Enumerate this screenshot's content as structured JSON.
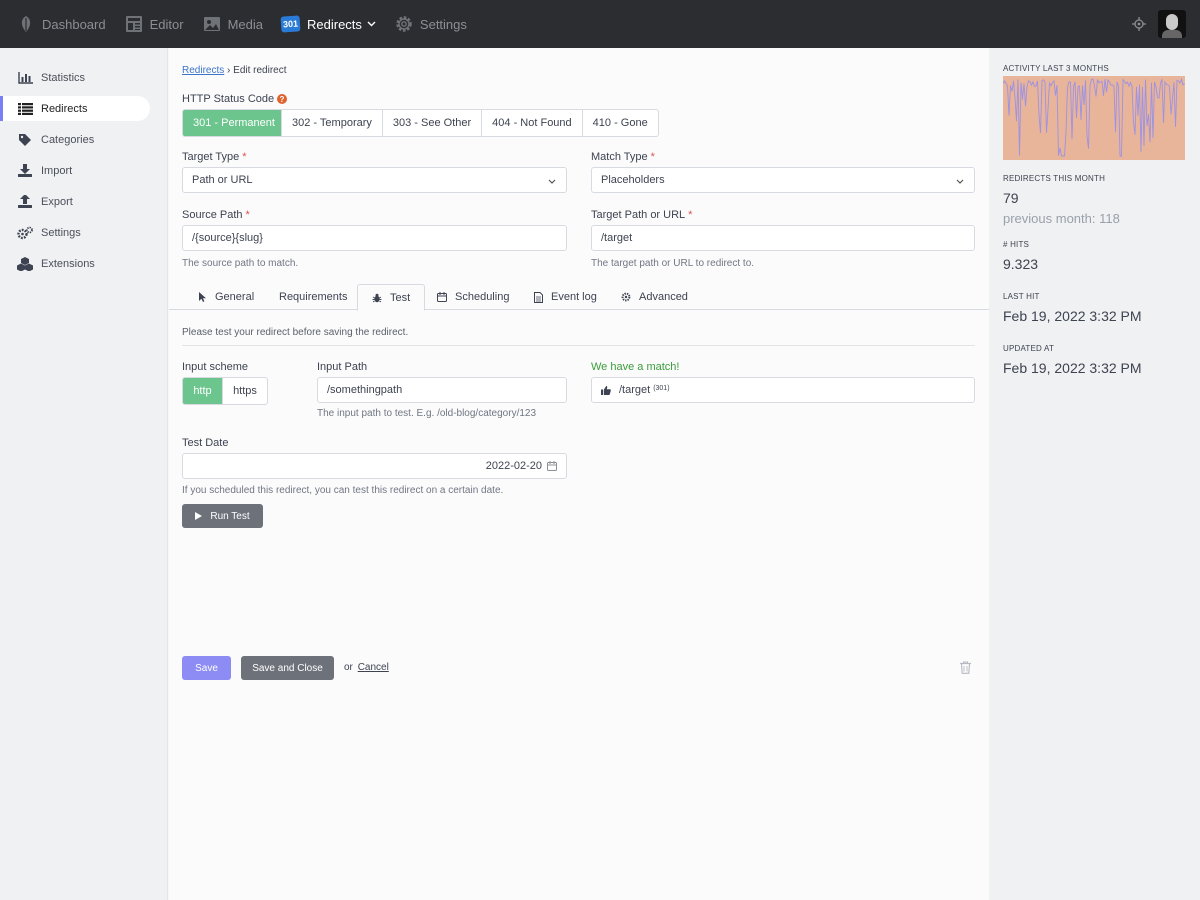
{
  "topnav": {
    "items": [
      {
        "label": "Dashboard",
        "icon": "dashboard-icon"
      },
      {
        "label": "Editor",
        "icon": "editor-icon"
      },
      {
        "label": "Media",
        "icon": "media-icon"
      },
      {
        "label": "Redirects",
        "icon": "redirects-301-icon",
        "badge": "301"
      },
      {
        "label": "Settings",
        "icon": "settings-gear-icon"
      }
    ],
    "active": "Redirects"
  },
  "sidebar": {
    "items": [
      {
        "label": "Statistics",
        "icon": "bar-chart-icon"
      },
      {
        "label": "Redirects",
        "icon": "list-icon"
      },
      {
        "label": "Categories",
        "icon": "tag-icon"
      },
      {
        "label": "Import",
        "icon": "download-icon"
      },
      {
        "label": "Export",
        "icon": "upload-icon"
      },
      {
        "label": "Settings",
        "icon": "gears-icon"
      },
      {
        "label": "Extensions",
        "icon": "cubes-icon"
      }
    ],
    "active": "Redirects"
  },
  "breadcrumb": {
    "parent": "Redirects",
    "separator": "›",
    "current": "Edit redirect"
  },
  "status_code": {
    "label": "HTTP Status Code",
    "options": [
      "301 - Permanent",
      "302 - Temporary",
      "303 - See Other",
      "404 - Not Found",
      "410 - Gone"
    ],
    "selected": "301 - Permanent"
  },
  "form": {
    "target_type": {
      "label": "Target Type",
      "value": "Path or URL"
    },
    "match_type": {
      "label": "Match Type",
      "value": "Placeholders"
    },
    "source_path": {
      "label": "Source Path",
      "value": "/{source}{slug}",
      "help": "The source path to match."
    },
    "target_path": {
      "label": "Target Path or URL",
      "value": "/target",
      "help": "The target path or URL to redirect to."
    },
    "required_mark": "*"
  },
  "tabs": {
    "items": [
      "General",
      "Requirements",
      "Test",
      "Scheduling",
      "Event log",
      "Advanced"
    ],
    "active": "Test"
  },
  "test": {
    "intro": "Please test your redirect before saving the redirect.",
    "scheme": {
      "label": "Input scheme",
      "options": [
        "http",
        "https"
      ],
      "selected": "http"
    },
    "input_path": {
      "label": "Input Path",
      "value": "/somethingpath",
      "help": "The input path to test. E.g. /old-blog/category/123"
    },
    "result": {
      "label": "We have a match!",
      "target": "/target",
      "code": "(301)"
    },
    "test_date": {
      "label": "Test Date",
      "value": "2022-02-20",
      "help": "If you scheduled this redirect, you can test this redirect on a certain date."
    },
    "run_label": "Run Test"
  },
  "actions": {
    "save": "Save",
    "save_close": "Save and Close",
    "or": "or",
    "cancel": "Cancel"
  },
  "stats": {
    "activity_label": "ACTIVITY LAST 3 MONTHS",
    "redirects_month_label": "REDIRECTS THIS MONTH",
    "redirects_month": "79",
    "previous_month": "previous month: 118",
    "hits_label": "# HITS",
    "hits": "9.323",
    "last_hit_label": "LAST HIT",
    "last_hit": "Feb 19, 2022 3:32 PM",
    "updated_label": "UPDATED AT",
    "updated": "Feb 19, 2022 3:32 PM"
  },
  "colors": {
    "accent": "#7b7ff5",
    "success": "#6bc58d",
    "topbar": "#2b2d30",
    "link": "#3d74c8",
    "spark_fill": "#e8b49a",
    "spark_line": "#8f8cf0"
  }
}
